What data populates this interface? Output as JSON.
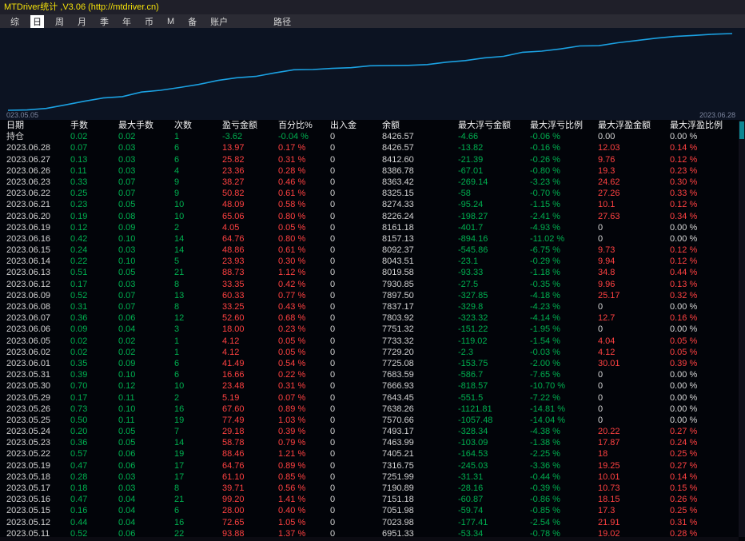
{
  "window": {
    "title": "MTDriver统计 ,V3.06 (http://mtdriver.cn)"
  },
  "menu": {
    "items": [
      "综",
      "日",
      "周",
      "月",
      "季",
      "年",
      "币",
      "M",
      "备",
      "账户"
    ],
    "selected": "日",
    "path_item": "路径"
  },
  "chart": {
    "start_label": "023.05.05",
    "end_label": "2023.06.28",
    "line_color": "#1ba1e2",
    "balance_curve": [
      6755,
      6762,
      6795,
      6872,
      6951.33,
      7023.98,
      7051.98,
      7151.18,
      7190.89,
      7251.99,
      7316.75,
      7405.21,
      7463.99,
      7493.17,
      7570.66,
      7638.26,
      7643.45,
      7666.93,
      7683.59,
      7725.08,
      7729.2,
      7733.32,
      7751.32,
      7803.92,
      7837.17,
      7897.5,
      7930.85,
      8019.58,
      8043.51,
      8092.37,
      8157.13,
      8161.18,
      8226.24,
      8274.33,
      8325.15,
      8363.42,
      8386.78,
      8412.6,
      8426.57
    ]
  },
  "colors": {
    "positive": "#ff4141",
    "negative": "#00b050",
    "neutral": "#d4d4d4",
    "accent_line": "#1ba1e2",
    "title_yellow": "#f5e20a",
    "scroll_thumb": "#0d8793"
  },
  "table": {
    "headers": [
      "日期",
      "手数",
      "最大手数",
      "次数",
      "盈亏金额",
      "百分比%",
      "出入金",
      "余额",
      "最大浮亏金额",
      "最大浮亏比例",
      "最大浮盈金额",
      "最大浮盈比例"
    ],
    "rows": [
      [
        "持仓",
        "0.02",
        "0.02",
        "1",
        "-3.62",
        "-0.04 %",
        "0",
        "8426.57",
        "-4.66",
        "-0.06 %",
        "0.00",
        "0.00 %"
      ],
      [
        "2023.06.28",
        "0.07",
        "0.03",
        "6",
        "13.97",
        "0.17 %",
        "0",
        "8426.57",
        "-13.82",
        "-0.16 %",
        "12.03",
        "0.14 %"
      ],
      [
        "2023.06.27",
        "0.13",
        "0.03",
        "6",
        "25.82",
        "0.31 %",
        "0",
        "8412.60",
        "-21.39",
        "-0.26 %",
        "9.76",
        "0.12 %"
      ],
      [
        "2023.06.26",
        "0.11",
        "0.03",
        "4",
        "23.36",
        "0.28 %",
        "0",
        "8386.78",
        "-67.01",
        "-0.80 %",
        "19.3",
        "0.23 %"
      ],
      [
        "2023.06.23",
        "0.33",
        "0.07",
        "9",
        "38.27",
        "0.46 %",
        "0",
        "8363.42",
        "-269.14",
        "-3.23 %",
        "24.62",
        "0.30 %"
      ],
      [
        "2023.06.22",
        "0.25",
        "0.07",
        "9",
        "50.82",
        "0.61 %",
        "0",
        "8325.15",
        "-58",
        "-0.70 %",
        "27.26",
        "0.33 %"
      ],
      [
        "2023.06.21",
        "0.23",
        "0.05",
        "10",
        "48.09",
        "0.58 %",
        "0",
        "8274.33",
        "-95.24",
        "-1.15 %",
        "10.1",
        "0.12 %"
      ],
      [
        "2023.06.20",
        "0.19",
        "0.08",
        "10",
        "65.06",
        "0.80 %",
        "0",
        "8226.24",
        "-198.27",
        "-2.41 %",
        "27.63",
        "0.34 %"
      ],
      [
        "2023.06.19",
        "0.12",
        "0.09",
        "2",
        "4.05",
        "0.05 %",
        "0",
        "8161.18",
        "-401.7",
        "-4.93 %",
        "0",
        "0.00 %"
      ],
      [
        "2023.06.16",
        "0.42",
        "0.10",
        "14",
        "64.76",
        "0.80 %",
        "0",
        "8157.13",
        "-894.16",
        "-11.02 %",
        "0",
        "0.00 %"
      ],
      [
        "2023.06.15",
        "0.24",
        "0.03",
        "14",
        "48.86",
        "0.61 %",
        "0",
        "8092.37",
        "-545.86",
        "-6.75 %",
        "9.73",
        "0.12 %"
      ],
      [
        "2023.06.14",
        "0.22",
        "0.10",
        "5",
        "23.93",
        "0.30 %",
        "0",
        "8043.51",
        "-23.1",
        "-0.29 %",
        "9.94",
        "0.12 %"
      ],
      [
        "2023.06.13",
        "0.51",
        "0.05",
        "21",
        "88.73",
        "1.12 %",
        "0",
        "8019.58",
        "-93.33",
        "-1.18 %",
        "34.8",
        "0.44 %"
      ],
      [
        "2023.06.12",
        "0.17",
        "0.03",
        "8",
        "33.35",
        "0.42 %",
        "0",
        "7930.85",
        "-27.5",
        "-0.35 %",
        "9.96",
        "0.13 %"
      ],
      [
        "2023.06.09",
        "0.52",
        "0.07",
        "13",
        "60.33",
        "0.77 %",
        "0",
        "7897.50",
        "-327.85",
        "-4.18 %",
        "25.17",
        "0.32 %"
      ],
      [
        "2023.06.08",
        "0.31",
        "0.07",
        "8",
        "33.25",
        "0.43 %",
        "0",
        "7837.17",
        "-329.8",
        "-4.23 %",
        "0",
        "0.00 %"
      ],
      [
        "2023.06.07",
        "0.36",
        "0.06",
        "12",
        "52.60",
        "0.68 %",
        "0",
        "7803.92",
        "-323.32",
        "-4.14 %",
        "12.7",
        "0.16 %"
      ],
      [
        "2023.06.06",
        "0.09",
        "0.04",
        "3",
        "18.00",
        "0.23 %",
        "0",
        "7751.32",
        "-151.22",
        "-1.95 %",
        "0",
        "0.00 %"
      ],
      [
        "2023.06.05",
        "0.02",
        "0.02",
        "1",
        "4.12",
        "0.05 %",
        "0",
        "7733.32",
        "-119.02",
        "-1.54 %",
        "4.04",
        "0.05 %"
      ],
      [
        "2023.06.02",
        "0.02",
        "0.02",
        "1",
        "4.12",
        "0.05 %",
        "0",
        "7729.20",
        "-2.3",
        "-0.03 %",
        "4.12",
        "0.05 %"
      ],
      [
        "2023.06.01",
        "0.35",
        "0.09",
        "6",
        "41.49",
        "0.54 %",
        "0",
        "7725.08",
        "-153.75",
        "-2.00 %",
        "30.01",
        "0.39 %"
      ],
      [
        "2023.05.31",
        "0.39",
        "0.10",
        "6",
        "16.66",
        "0.22 %",
        "0",
        "7683.59",
        "-586.7",
        "-7.65 %",
        "0",
        "0.00 %"
      ],
      [
        "2023.05.30",
        "0.70",
        "0.12",
        "10",
        "23.48",
        "0.31 %",
        "0",
        "7666.93",
        "-818.57",
        "-10.70 %",
        "0",
        "0.00 %"
      ],
      [
        "2023.05.29",
        "0.17",
        "0.11",
        "2",
        "5.19",
        "0.07 %",
        "0",
        "7643.45",
        "-551.5",
        "-7.22 %",
        "0",
        "0.00 %"
      ],
      [
        "2023.05.26",
        "0.73",
        "0.10",
        "16",
        "67.60",
        "0.89 %",
        "0",
        "7638.26",
        "-1121.81",
        "-14.81 %",
        "0",
        "0.00 %"
      ],
      [
        "2023.05.25",
        "0.50",
        "0.11",
        "19",
        "77.49",
        "1.03 %",
        "0",
        "7570.66",
        "-1057.48",
        "-14.04 %",
        "0",
        "0.00 %"
      ],
      [
        "2023.05.24",
        "0.20",
        "0.05",
        "7",
        "29.18",
        "0.39 %",
        "0",
        "7493.17",
        "-328.34",
        "-4.38 %",
        "20.22",
        "0.27 %"
      ],
      [
        "2023.05.23",
        "0.36",
        "0.05",
        "14",
        "58.78",
        "0.79 %",
        "0",
        "7463.99",
        "-103.09",
        "-1.38 %",
        "17.87",
        "0.24 %"
      ],
      [
        "2023.05.22",
        "0.57",
        "0.06",
        "19",
        "88.46",
        "1.21 %",
        "0",
        "7405.21",
        "-164.53",
        "-2.25 %",
        "18",
        "0.25 %"
      ],
      [
        "2023.05.19",
        "0.47",
        "0.06",
        "17",
        "64.76",
        "0.89 %",
        "0",
        "7316.75",
        "-245.03",
        "-3.36 %",
        "19.25",
        "0.27 %"
      ],
      [
        "2023.05.18",
        "0.28",
        "0.03",
        "17",
        "61.10",
        "0.85 %",
        "0",
        "7251.99",
        "-31.31",
        "-0.44 %",
        "10.01",
        "0.14 %"
      ],
      [
        "2023.05.17",
        "0.18",
        "0.03",
        "8",
        "39.71",
        "0.56 %",
        "0",
        "7190.89",
        "-28.16",
        "-0.39 %",
        "10.73",
        "0.15 %"
      ],
      [
        "2023.05.16",
        "0.47",
        "0.04",
        "21",
        "99.20",
        "1.41 %",
        "0",
        "7151.18",
        "-60.87",
        "-0.86 %",
        "18.15",
        "0.26 %"
      ],
      [
        "2023.05.15",
        "0.16",
        "0.04",
        "6",
        "28.00",
        "0.40 %",
        "0",
        "7051.98",
        "-59.74",
        "-0.85 %",
        "17.3",
        "0.25 %"
      ],
      [
        "2023.05.12",
        "0.44",
        "0.04",
        "16",
        "72.65",
        "1.05 %",
        "0",
        "7023.98",
        "-177.41",
        "-2.54 %",
        "21.91",
        "0.31 %"
      ],
      [
        "2023.05.11",
        "0.52",
        "0.06",
        "22",
        "93.88",
        "1.37 %",
        "0",
        "6951.33",
        "-53.34",
        "-0.78 %",
        "19.02",
        "0.28 %"
      ]
    ]
  }
}
